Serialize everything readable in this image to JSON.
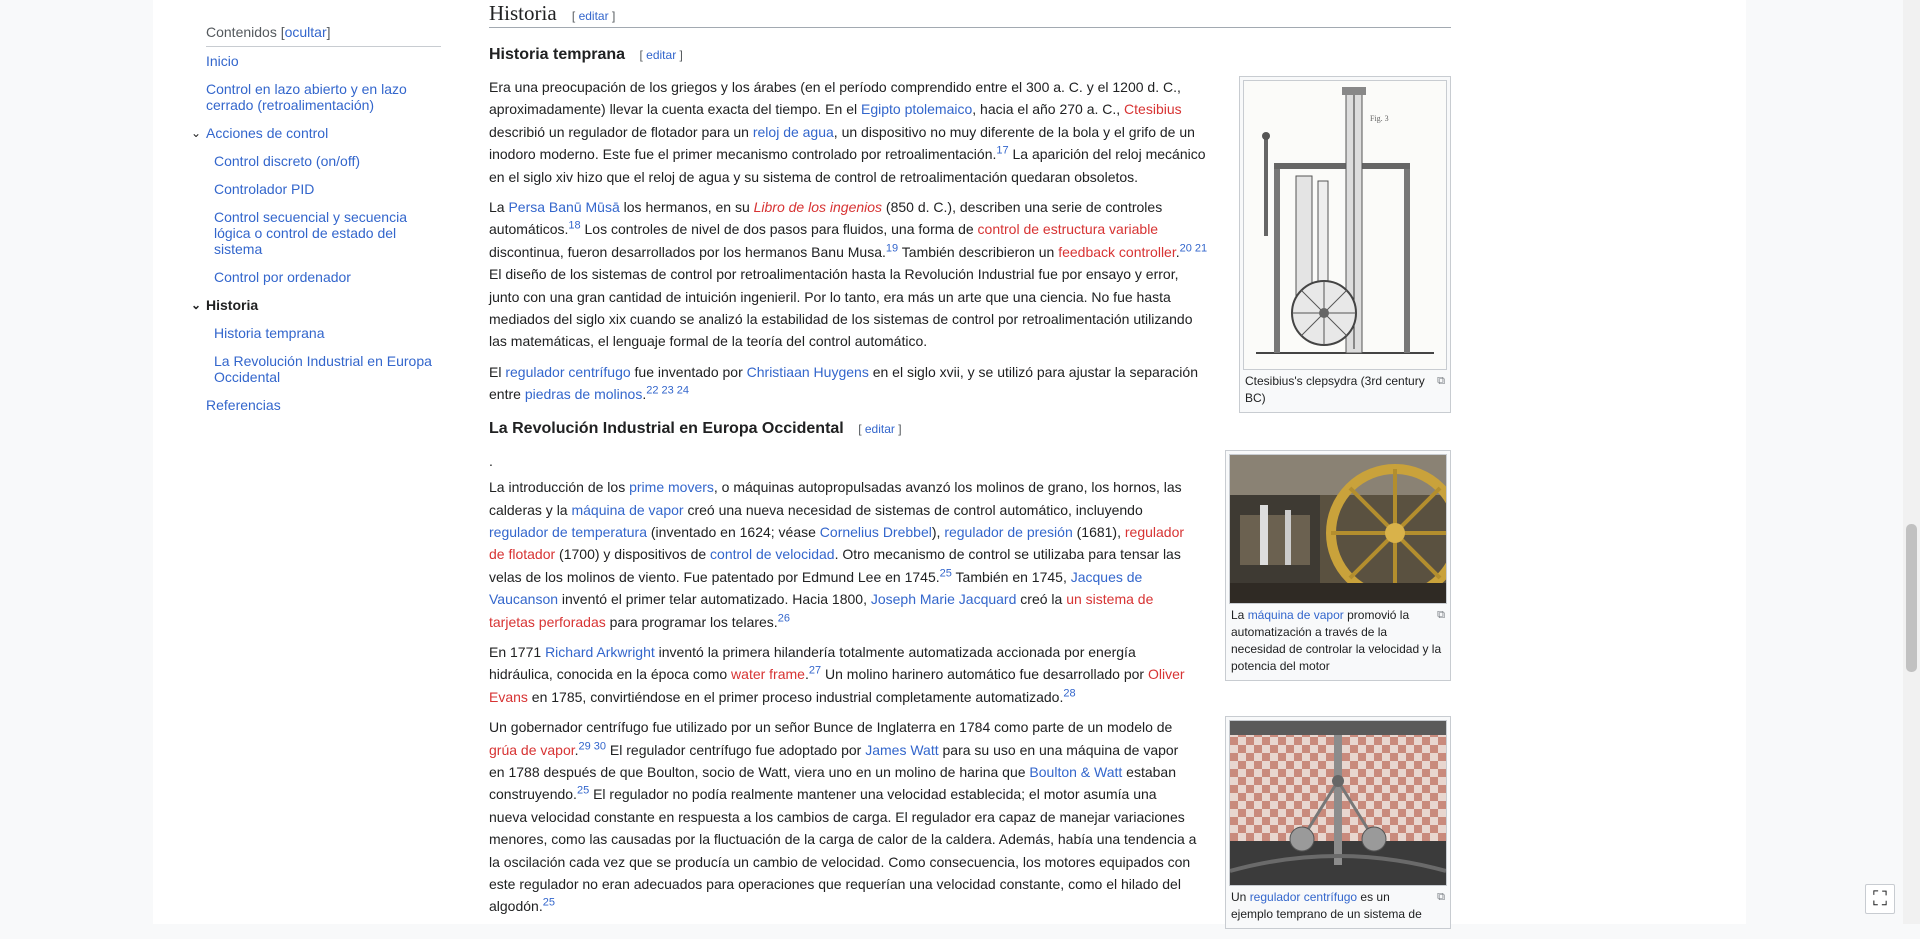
{
  "toc": {
    "title": "Contenidos",
    "hide_label": "ocultar",
    "items": [
      "Inicio",
      "Control en lazo abierto y en lazo cerrado (retroalimentación)",
      "Acciones de control",
      "Control discreto (on/off)",
      "Controlador PID",
      "Control secuencial y secuencia lógica o control de estado del sistema",
      "Control por ordenador",
      "Historia",
      "Historia temprana",
      "La Revolución Industrial en Europa Occidental",
      "Referencias"
    ]
  },
  "section": {
    "title": "Historia",
    "edit": "editar"
  },
  "early": {
    "title": "Historia temprana",
    "edit": "editar",
    "p1": [
      "Era una preocupación de los griegos y los árabes (en el período comprendido entre el 300 a. C. y el 1200 d. C., aproximadamente) llevar la cuenta exacta del tiempo. En el ",
      "Egipto ptolemaico",
      ", hacia el año 270 a. C., ",
      "Ctesibius",
      " describió un regulador de flotador para un ",
      "reloj de agua",
      ", un dispositivo no muy diferente de la bola y el grifo de un inodoro moderno. Este fue el primer mecanismo controlado por retroalimentación.",
      "17",
      "  La aparición del reloj mecánico en el siglo xiv hizo que el reloj de agua y su sistema de control de retroalimentación quedaran obsoletos."
    ],
    "p2": [
      "La ",
      "Persa Banū Mūsā",
      " los hermanos, en su ",
      "Libro de los ingenios",
      " (850 d. C.), describen una serie de controles automáticos.",
      "18",
      "  Los controles de nivel de dos pasos para fluidos, una forma de ",
      "control de estructura variable",
      " discontinua, fueron desarrollados por los hermanos Banu Musa.",
      "19",
      "  También describieron un ",
      "feedback controller",
      ".",
      "20 21",
      "  El diseño de los sistemas de control por retroalimentación hasta la Revolución Industrial fue por ensayo y error, junto con una gran cantidad de intuición ingenieril. Por lo tanto, era más un arte que una ciencia. No fue hasta mediados del siglo xix cuando se analizó la estabilidad de los sistemas de control por retroalimentación utilizando las matemáticas, el lenguaje formal de la teoría del control automático."
    ],
    "p3": [
      "El ",
      "regulador centrífugo",
      " fue inventado por ",
      "Christiaan Huygens",
      " en el siglo xvii, y se utilizó para ajustar la separación entre ",
      "piedras de molinos",
      ".",
      "22 23 24"
    ],
    "figure_caption": "Ctesibius's clepsydra (3rd century BC)"
  },
  "industrial": {
    "title": "La Revolución Industrial en Europa Occidental",
    "edit": "editar",
    "dot": ".",
    "p1": [
      "La introducción de los ",
      "prime movers",
      ", o máquinas autopropulsadas avanzó los molinos de grano, los hornos, las calderas y la ",
      "máquina de vapor",
      " creó una nueva necesidad de sistemas de control automático, incluyendo ",
      "regulador de temperatura",
      " (inventado en 1624; véase ",
      "Cornelius Drebbel",
      "), ",
      "regulador de presión",
      " (1681), ",
      "regulador de flotador",
      " (1700) y dispositivos de ",
      "control de velocidad",
      ". Otro mecanismo de control se utilizaba para tensar las velas de los molinos de viento. Fue patentado por Edmund Lee en 1745.",
      "25",
      "  También en 1745, ",
      "Jacques de Vaucanson",
      " inventó el primer telar automatizado. Hacia 1800, ",
      "Joseph Marie Jacquard",
      " creó la ",
      "un sistema de tarjetas perforadas",
      " para programar los telares.",
      "26"
    ],
    "p2": [
      "En 1771 ",
      "Richard Arkwright",
      " inventó la primera hilandería totalmente automatizada accionada por energía hidráulica, conocida en la época como ",
      "water frame",
      ".",
      "27",
      "  Un molino harinero automático fue desarrollado por ",
      "Oliver Evans",
      " en 1785, convirtiéndose en el primer proceso industrial completamente automatizado.",
      "28"
    ],
    "p3": [
      "Un gobernador centrífugo fue utilizado por un señor Bunce de Inglaterra en 1784 como parte de un modelo de ",
      "grúa de vapor",
      ".",
      "29 30",
      "  El regulador centrífugo fue adoptado por ",
      "James Watt",
      " para su uso en una máquina de vapor en 1788 después de que Boulton, socio de Watt, viera uno en un molino de harina que ",
      "Boulton & Watt",
      " estaban construyendo.",
      "25",
      "  El regulador no podía realmente mantener una velocidad establecida; el motor asumía una nueva velocidad constante en respuesta a los cambios de carga. El regulador era capaz de manejar variaciones menores, como las causadas por la fluctuación de la carga de calor de la caldera. Además, había una tendencia a la oscilación cada vez que se producía un cambio de velocidad. Como consecuencia, los motores equipados con este regulador no eran adecuados para operaciones que requerían una velocidad constante, como el hilado del algodón.",
      "25"
    ],
    "figure1_caption": [
      "La ",
      "máquina de vapor",
      " promovió la automatización a través de la necesidad de controlar la velocidad y la potencia del motor"
    ],
    "figure2_caption": [
      "Un ",
      "regulador centrífugo",
      " es un ejemplo temprano de un sistema de"
    ]
  },
  "ui": {
    "fullscreen_icon": "fullscreen-icon"
  },
  "colors": {
    "link": "#3366cc",
    "redlink": "#d73333",
    "text": "#202122",
    "background": "#f8f9fa"
  }
}
